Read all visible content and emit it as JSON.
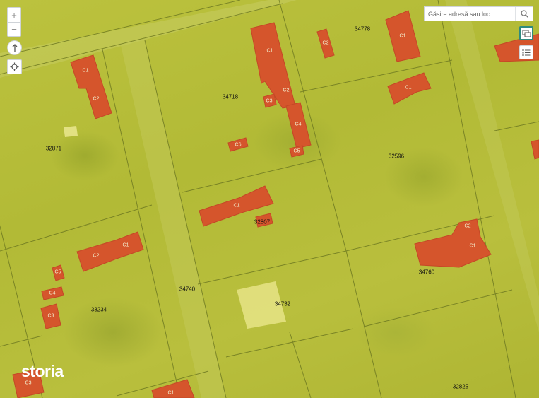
{
  "search": {
    "placeholder": "Găsire adresă sau loc"
  },
  "controls": {
    "zoom_in": "+",
    "zoom_out": "−"
  },
  "logo": "storia",
  "parcels": [
    "34778",
    "34718",
    "32871",
    "32596",
    "32807",
    "34740",
    "34732",
    "33234",
    "34760",
    "32825"
  ],
  "buildings": [
    "C1",
    "C2",
    "C1",
    "C2",
    "C3",
    "C4",
    "C5",
    "C6",
    "C2",
    "C1",
    "C1",
    "C1",
    "C2",
    "C1",
    "C2",
    "C1",
    "C5",
    "C4",
    "C3",
    "C2",
    "C3",
    "C1"
  ],
  "colors": {
    "building_fill": "#d5552c",
    "building_edge": "#c44826",
    "map_base": "#b8bf3a",
    "parcel_line": "#6f7a22"
  }
}
